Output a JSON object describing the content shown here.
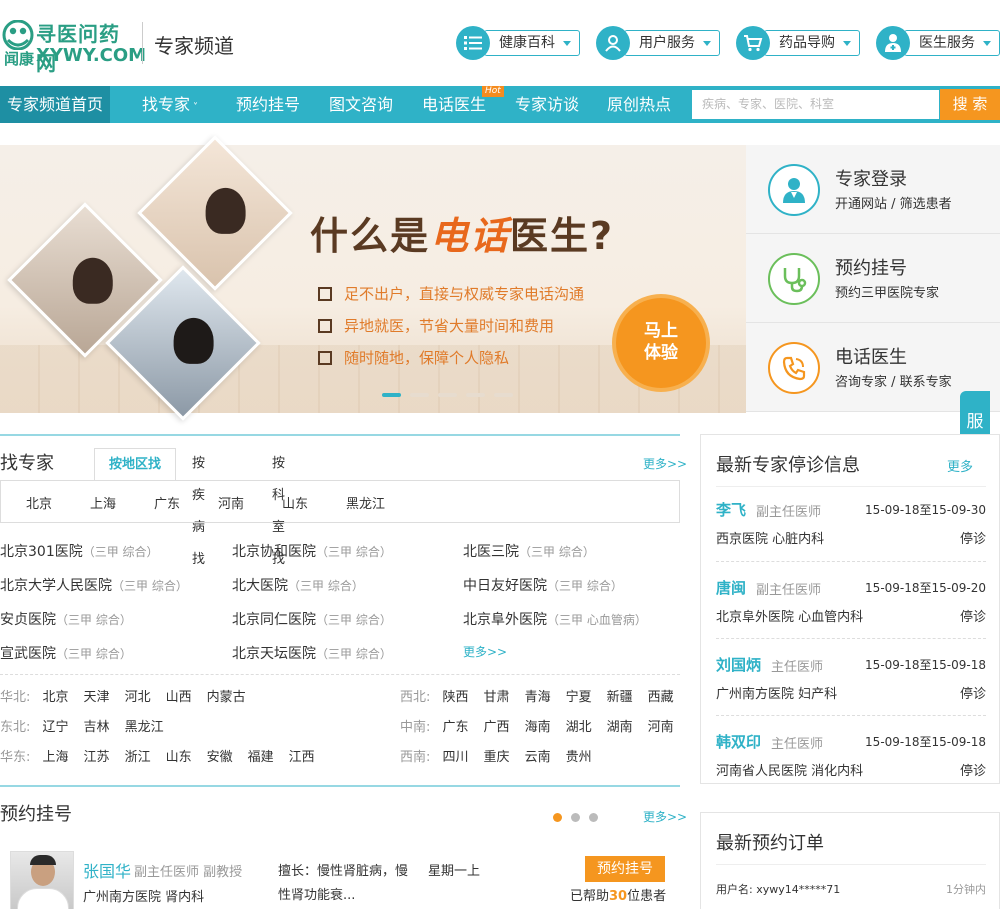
{
  "header": {
    "logo_cn": "寻医问药网",
    "logo_small": "闻康",
    "logo_en": "XYWY.COM",
    "channel_title": "专家频道",
    "menus": [
      {
        "label": "健康百科",
        "icon": "list-icon"
      },
      {
        "label": "用户服务",
        "icon": "user-icon"
      },
      {
        "label": "药品导购",
        "icon": "cart-icon"
      },
      {
        "label": "医生服务",
        "icon": "doctor-icon"
      }
    ]
  },
  "nav": {
    "items": [
      "专家频道首页",
      "找专家",
      "预约挂号",
      "图文咨询",
      "电话医生",
      "专家访谈",
      "原创热点"
    ],
    "hot_badge": "Hot",
    "search_placeholder": "疾病、专家、医院、科室",
    "search_button": "搜 索"
  },
  "banner": {
    "title_pre": "什么是",
    "title_accent": "电话",
    "title_post": "医生?",
    "features": [
      "足不出户，直接与权威专家电话沟通",
      "异地就医，节省大量时间和费用",
      "随时随地，保障个人隐私"
    ],
    "cta_line1": "马上",
    "cta_line2": "体验"
  },
  "quick_links": [
    {
      "title": "专家登录",
      "sub": "开通网站 / 筛选患者",
      "color": "#2fb2c7",
      "icon": "doctor-login-icon"
    },
    {
      "title": "预约挂号",
      "sub": "预约三甲医院专家",
      "color": "#6bbf5b",
      "icon": "stethoscope-icon"
    },
    {
      "title": "电话医生",
      "sub": "咨询专家 / 联系专家",
      "color": "#f5961f",
      "icon": "phone-icon"
    }
  ],
  "service_tab": "服务台",
  "find": {
    "title": "找专家",
    "tabs": [
      "按地区找",
      "按疾病找",
      "按科室找"
    ],
    "more": "更多>>",
    "regions": [
      "北京",
      "上海",
      "广东",
      "河南",
      "山东",
      "黑龙江"
    ],
    "hospitals": [
      {
        "name": "北京301医院",
        "level": "（三甲  综合）"
      },
      {
        "name": "北京协和医院",
        "level": "（三甲  综合）"
      },
      {
        "name": "北医三院",
        "level": "（三甲  综合）"
      },
      {
        "name": "北京大学人民医院",
        "level": "（三甲  综合）"
      },
      {
        "name": "北大医院",
        "level": "（三甲  综合）"
      },
      {
        "name": "中日友好医院",
        "level": "（三甲  综合）"
      },
      {
        "name": "安贞医院",
        "level": "（三甲  综合）"
      },
      {
        "name": "北京同仁医院",
        "level": "（三甲  综合）"
      },
      {
        "name": "北京阜外医院",
        "level": "（三甲  心血管病）"
      },
      {
        "name": "宣武医院",
        "level": "（三甲  综合）"
      },
      {
        "name": "北京天坛医院",
        "level": "（三甲  综合）"
      }
    ],
    "more_hospitals": "更多>>",
    "areas_left": [
      {
        "label": "华北:",
        "cities": [
          "北京",
          "天津",
          "河北",
          "山西",
          "内蒙古"
        ]
      },
      {
        "label": "东北:",
        "cities": [
          "辽宁",
          "吉林",
          "黑龙江"
        ]
      },
      {
        "label": "华东:",
        "cities": [
          "上海",
          "江苏",
          "浙江",
          "山东",
          "安徽",
          "福建",
          "江西"
        ]
      }
    ],
    "areas_right": [
      {
        "label": "西北:",
        "cities": [
          "陕西",
          "甘肃",
          "青海",
          "宁夏",
          "新疆",
          "西藏"
        ]
      },
      {
        "label": "中南:",
        "cities": [
          "广东",
          "广西",
          "海南",
          "湖北",
          "湖南",
          "河南"
        ]
      },
      {
        "label": "西南:",
        "cities": [
          "四川",
          "重庆",
          "云南",
          "贵州"
        ]
      }
    ]
  },
  "appointment": {
    "title": "预约挂号",
    "more": "更多>>",
    "doctor": {
      "name": "张国华",
      "rank": "副主任医师  副教授",
      "hospital": "广州南方医院  肾内科",
      "skill": "擅长：慢性肾脏病，慢性肾功能衰...",
      "time": "星期一上",
      "button": "预约挂号",
      "helped_pre": "已帮助",
      "helped_num": "30",
      "helped_post": "位患者"
    }
  },
  "stop_info": {
    "title": "最新专家停诊信息",
    "more": "更多",
    "items": [
      {
        "name": "李飞",
        "rank": "副主任医师",
        "date": "15-09-18至15-09-30",
        "hospital": "西京医院  心脏内科",
        "status": "停诊"
      },
      {
        "name": "唐闽",
        "rank": "副主任医师",
        "date": "15-09-18至15-09-20",
        "hospital": "北京阜外医院  心血管内科",
        "status": "停诊"
      },
      {
        "name": "刘国炳",
        "rank": "主任医师",
        "date": "15-09-18至15-09-18",
        "hospital": "广州南方医院  妇产科",
        "status": "停诊"
      },
      {
        "name": "韩双印",
        "rank": "主任医师",
        "date": "15-09-18至15-09-18",
        "hospital": "河南省人民医院  消化内科",
        "status": "停诊"
      }
    ]
  },
  "orders": {
    "title": "最新预约订单",
    "items": [
      {
        "user": "用户名: xywy14*****71",
        "time": "1分钟内"
      }
    ]
  }
}
